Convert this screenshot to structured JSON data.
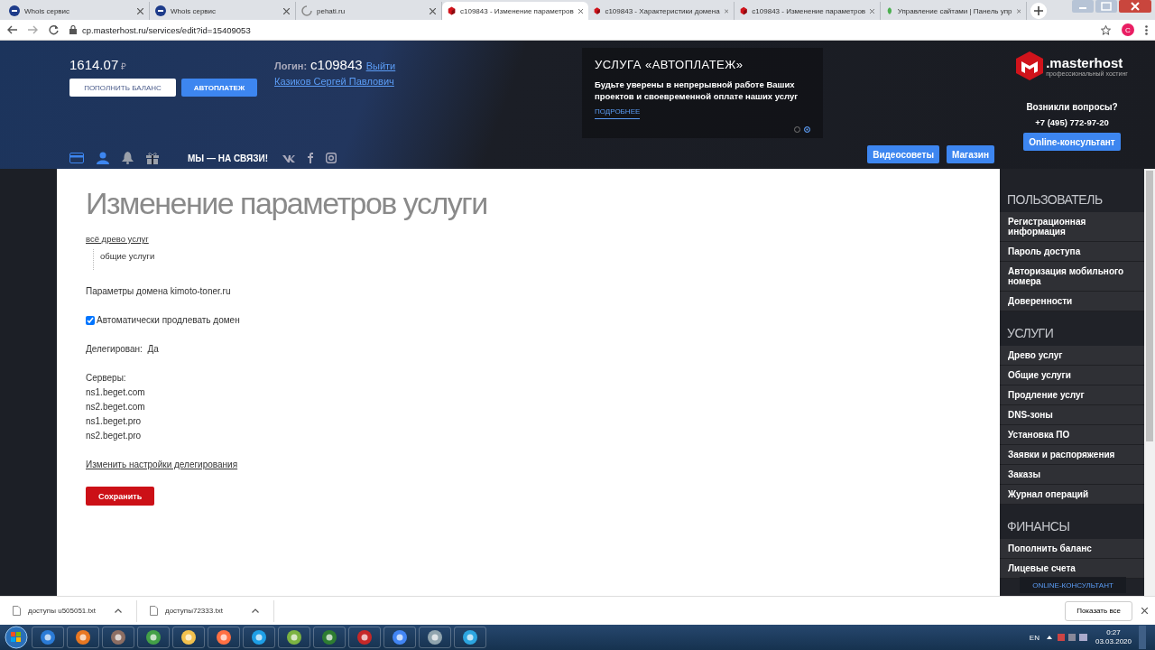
{
  "browser_tabs": [
    {
      "title": "Whois сервис",
      "kind": "ru",
      "selected": false
    },
    {
      "title": "Whois сервис",
      "kind": "ru",
      "selected": false
    },
    {
      "title": "pehati.ru",
      "kind": "loading",
      "selected": false
    },
    {
      "title": "c109843 - Изменение параметров",
      "kind": "masterhost",
      "selected": true
    },
    {
      "title": "c109843 - Характеристики домена",
      "kind": "masterhost",
      "selected": false
    },
    {
      "title": "c109843 - Изменение параметров",
      "kind": "masterhost",
      "selected": false
    },
    {
      "title": "Управление сайтами | Панель упр",
      "kind": "leaf",
      "selected": false
    }
  ],
  "address_bar": {
    "url": "cp.masterhost.ru/services/edit?id=15409053",
    "profile": "C"
  },
  "header": {
    "balance": "1614.07",
    "currency": "₽",
    "balance_buttons": [
      {
        "label": "ПОПОЛНИТЬ БАЛАНС",
        "kind": "outline"
      },
      {
        "label": "АВТОПЛАТЕЖ",
        "kind": "primary"
      }
    ],
    "login_label": "Логин:",
    "login": "c109843",
    "logout": "Выйти",
    "user_name": "Казиков Сергей Павлович",
    "account_icons": [
      {
        "kind": "card",
        "active": true
      },
      {
        "kind": "user",
        "active": true
      },
      {
        "kind": "bell",
        "active": false
      },
      {
        "kind": "gift",
        "active": false
      }
    ],
    "contact_label": "МЫ — НА СВЯЗИ!",
    "promo": {
      "title": "УСЛУГА «АВТОПЛАТЕЖ»",
      "text": "Будьте уверены в непрерывной работе Ваших проектов и своевременной оплате наших услуг",
      "link": "ПОДРОБНЕЕ",
      "dots": [
        {
          "selected": false
        },
        {
          "selected": true
        }
      ]
    },
    "nav_buttons": [
      "Видеосоветы",
      "Магазин"
    ],
    "logo": {
      "name": ".masterhost",
      "tagline": "профессиональный хостинг"
    },
    "help": "Возникли вопросы?",
    "phone": "+7 (495) 772-97-20",
    "consultant_button": "Online-консультант"
  },
  "content": {
    "title": "Изменение параметров услуги",
    "tree": {
      "label": "всё древо услуг",
      "children": [
        {
          "label": "общие услуги"
        }
      ]
    },
    "domain_params": "Параметры домена kimoto-toner.ru",
    "checkbox": {
      "label": "Автоматически продлевать домен",
      "checked": true
    },
    "delegated": {
      "label": "Делегирован:",
      "value": "Да"
    },
    "servers": {
      "label": "Серверы:",
      "items": [
        "ns1.beget.com",
        "ns2.beget.com",
        "ns1.beget.pro",
        "ns2.beget.pro"
      ]
    },
    "change_link": "Изменить настройки делегирования",
    "save_button": "Сохранить"
  },
  "sidebar": {
    "sections": [
      {
        "title": "ПОЛЬЗОВАТЕЛЬ",
        "items": [
          "Регистрационная информация",
          "Пароль доступа",
          "Авторизация мобильного номера",
          "Доверенности"
        ]
      },
      {
        "title": "УСЛУГИ",
        "items": [
          "Древо услуг",
          "Общие услуги",
          "Продление услуг",
          "DNS-зоны",
          "Установка ПО",
          "Заявки и распоряжения",
          "Заказы",
          "Журнал операций"
        ]
      },
      {
        "title": "ФИНАНСЫ",
        "items": [
          "Пополнить баланс",
          "Лицевые счета"
        ]
      }
    ],
    "floating_button": "ONLINE-КОНСУЛЬТАНТ"
  },
  "downloads": {
    "items": [
      {
        "name": "доступы u505051.txt"
      },
      {
        "name": "доступы72333.txt"
      }
    ],
    "show_all": "Показать все"
  },
  "taskbar": {
    "language": "EN",
    "time": "0:27",
    "date": "03.03.2020"
  }
}
